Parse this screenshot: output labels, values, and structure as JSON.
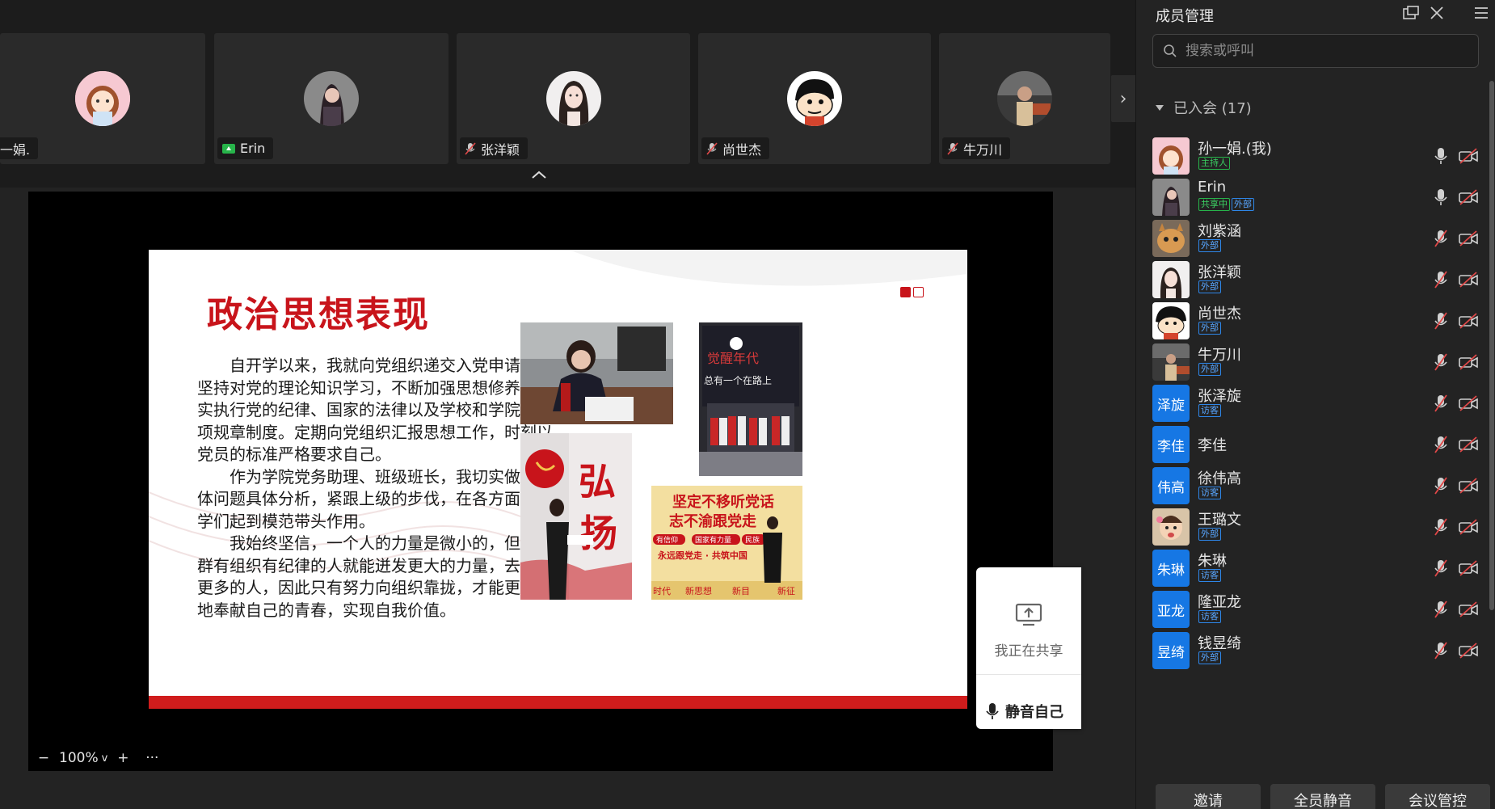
{
  "video_strip": {
    "tiles": [
      {
        "name": "一娟.",
        "indicator": "none"
      },
      {
        "name": "Erin",
        "indicator": "sharing"
      },
      {
        "name": "张洋颖",
        "indicator": "mic-off"
      },
      {
        "name": "尚世杰",
        "indicator": "mic-off"
      },
      {
        "name": "牛万川",
        "indicator": "mic-off"
      }
    ]
  },
  "slide": {
    "title": "政治思想表现",
    "paragraphs": [
      "自开学以来，我就向党组织递交入党申请书，坚持对党的理论知识学习，不断加强思想修养，切实执行党的纪律、国家的法律以及学校和学院的各项规章制度。定期向党组织汇报思想工作，时刻以党员的标准严格要求自己。",
      "作为学院党务助理、班级班长，我切实做到具体问题具体分析，紧跟上级的步伐，在各方面给同学们起到模范带头作用。",
      "我始终坚信，一个人的力量是微小的，但是一群有组织有纪律的人就能迸发更大的力量，去帮助更多的人，因此只有努力向组织靠拢，才能更好的地奉献自己的青春，实现自我价值。"
    ],
    "photo_texts": {
      "poster_top": "坚定不移听党话",
      "poster_mid": "志不渝跟党走",
      "poster_chip1": "有信仰",
      "poster_chip2": "国家有力量",
      "poster_chip3": "民族",
      "poster_slogan": "永远跟党走 · 共筑中国",
      "poster_bottom1": "时代",
      "poster_bottom2": "新思想",
      "poster_bottom3": "新目",
      "poster_bottom4": "新征",
      "board_text1": "觉醒年代",
      "board_text2": "总有一个在路上",
      "calligraphy1": "弘",
      "calligraphy2": "扬"
    }
  },
  "zoom": {
    "level": "100%",
    "minus": "−",
    "plus": "+",
    "more": "···",
    "caret": "v"
  },
  "share_panel": {
    "status": "我正在共享",
    "mute_self": "静音自己"
  },
  "member_panel": {
    "title": "成员管理",
    "search_placeholder": "搜索或呼叫",
    "group_label": "已入会 (17)",
    "members": [
      {
        "name": "孙一娟.(我)",
        "tags": [
          {
            "text": "主持人",
            "color": "green"
          }
        ],
        "avatar": "photo",
        "mic": "on"
      },
      {
        "name": "Erin",
        "tags": [
          {
            "text": "共享中",
            "color": "green"
          },
          {
            "text": "外部",
            "color": "blue"
          }
        ],
        "avatar": "photo",
        "mic": "on"
      },
      {
        "name": "刘紫涵",
        "tags": [
          {
            "text": "外部",
            "color": "blue"
          }
        ],
        "avatar": "photo",
        "mic": "off"
      },
      {
        "name": "张洋颖",
        "tags": [
          {
            "text": "外部",
            "color": "blue"
          }
        ],
        "avatar": "photo",
        "mic": "off"
      },
      {
        "name": "尚世杰",
        "tags": [
          {
            "text": "外部",
            "color": "blue"
          }
        ],
        "avatar": "photo",
        "mic": "off"
      },
      {
        "name": "牛万川",
        "tags": [
          {
            "text": "外部",
            "color": "blue"
          }
        ],
        "avatar": "photo",
        "mic": "off"
      },
      {
        "name": "张泽旋",
        "tags": [
          {
            "text": "访客",
            "color": "blue"
          }
        ],
        "avatar": "initials",
        "initials": "泽旋",
        "mic": "off"
      },
      {
        "name": "李佳",
        "tags": [],
        "avatar": "initials",
        "initials": "李佳",
        "mic": "off"
      },
      {
        "name": "徐伟高",
        "tags": [
          {
            "text": "访客",
            "color": "blue"
          }
        ],
        "avatar": "initials",
        "initials": "伟高",
        "mic": "off"
      },
      {
        "name": "王璐文",
        "tags": [
          {
            "text": "外部",
            "color": "blue"
          }
        ],
        "avatar": "photo",
        "mic": "off"
      },
      {
        "name": "朱琳",
        "tags": [
          {
            "text": "访客",
            "color": "blue"
          }
        ],
        "avatar": "initials",
        "initials": "朱琳",
        "mic": "off"
      },
      {
        "name": "隆亚龙",
        "tags": [
          {
            "text": "访客",
            "color": "blue"
          }
        ],
        "avatar": "initials",
        "initials": "亚龙",
        "mic": "off"
      },
      {
        "name": "钱昱绮",
        "tags": [
          {
            "text": "外部",
            "color": "blue"
          }
        ],
        "avatar": "initials",
        "initials": "昱绮",
        "mic": "off"
      }
    ],
    "footer_buttons": [
      "邀请",
      "全员静音",
      "会议管控"
    ]
  },
  "colors": {
    "accent": "#1677e4",
    "slide_red": "#c8141b",
    "bg": "#1c1c1c",
    "panel": "#232323"
  }
}
